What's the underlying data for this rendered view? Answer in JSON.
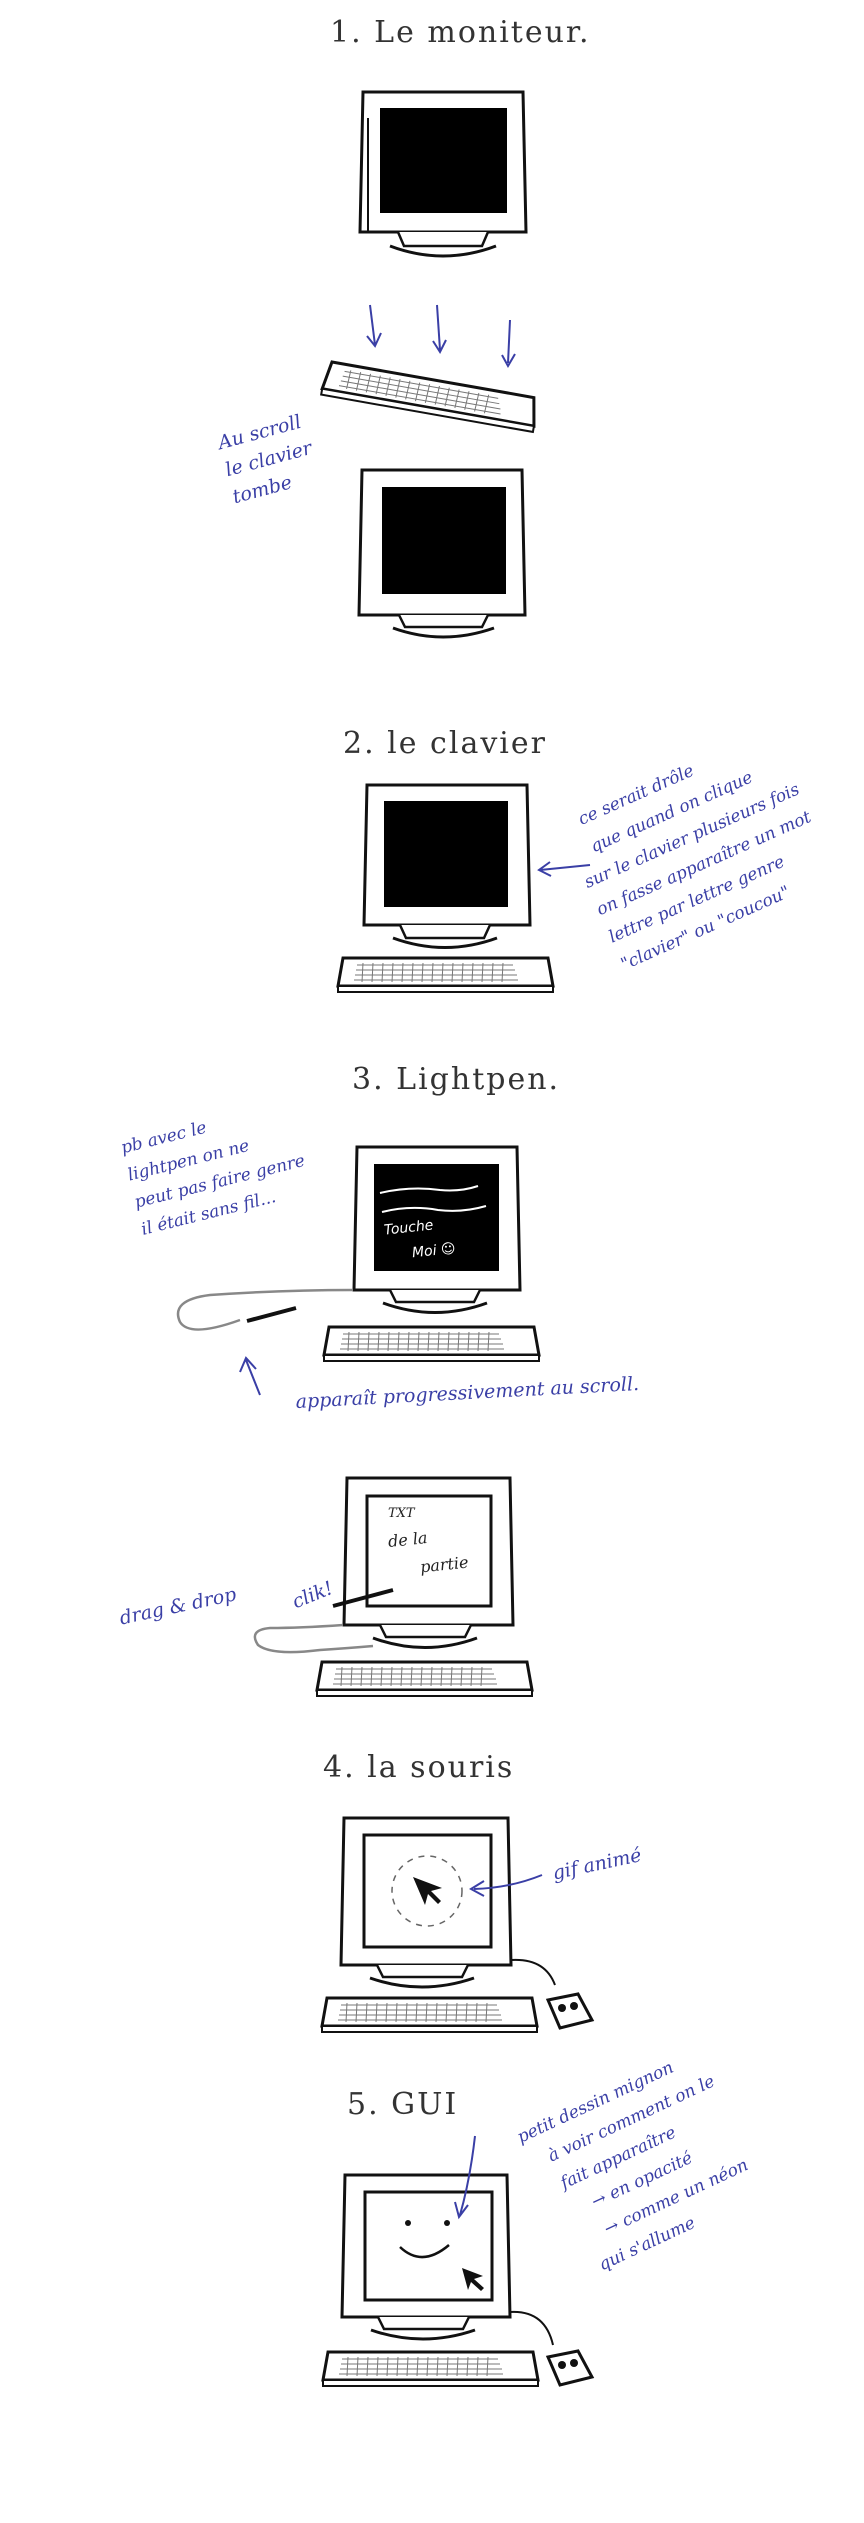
{
  "sections": {
    "s1": {
      "title": "1. Le moniteur."
    },
    "s2": {
      "title": "2. le clavier"
    },
    "s3": {
      "title": "3. Lightpen."
    },
    "s4": {
      "title": "4. la souris"
    },
    "s5": {
      "title": "5. GUI"
    }
  },
  "notes": {
    "scroll": [
      "Au scroll",
      "le clavier",
      "tombe"
    ],
    "clavier": [
      "ce serait drôle",
      "que quand on clique",
      "sur le clavier plusieurs fois",
      "on fasse apparaître un mot",
      "lettre par lettre genre",
      "\"clavier\" ou \"coucou\""
    ],
    "lightpen": [
      "pb avec le",
      "lightpen on ne",
      "peut pas faire genre",
      "il était sans fil..."
    ],
    "progressive": "apparaît progressivement au scroll.",
    "dragdrop": "drag & drop",
    "clik": "clik!",
    "gif": "gif animé",
    "gui": [
      "petit dessin mignon",
      "à voir comment on le",
      "fait apparaître",
      "→ en opacité",
      "→ comme un néon",
      "qui s'allume"
    ]
  },
  "screen_texts": {
    "lightpen_screen": [
      "Touche",
      "Moi ☺"
    ],
    "drag_screen": [
      "TXT",
      "de la",
      "partie"
    ]
  },
  "colors": {
    "ink": "#111111",
    "pencil": "#888888",
    "annotation": "#3a3fa6"
  }
}
